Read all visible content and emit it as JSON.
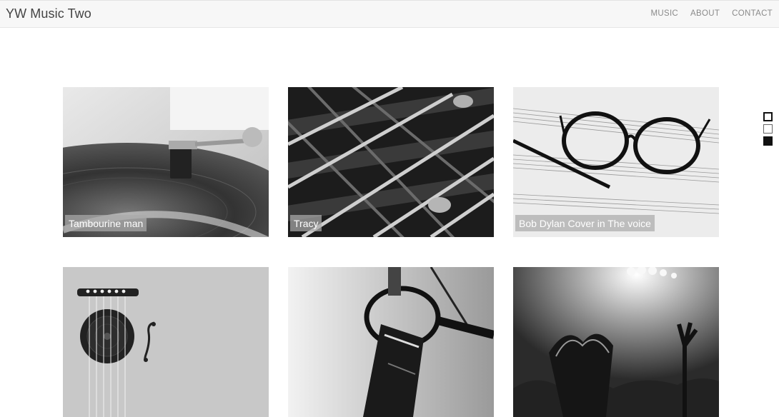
{
  "header": {
    "brand": "YW Music Two",
    "nav": [
      "MUSIC",
      "ABOUT",
      "CONTACT"
    ]
  },
  "gallery": {
    "cards": [
      {
        "caption": "Tambourine man",
        "image": "turntable-photo"
      },
      {
        "caption": "Tracy",
        "image": "guitar-strings-photo"
      },
      {
        "caption": "Bob Dylan Cover in The voice",
        "image": "glasses-on-sheet-music-photo"
      },
      {
        "caption": "",
        "image": "guitar-illustration"
      },
      {
        "caption": "",
        "image": "microphone-photo"
      },
      {
        "caption": "",
        "image": "concert-crowd-photo"
      }
    ]
  },
  "side_dots": {
    "count": 3,
    "active_index": 2
  },
  "colors": {
    "navbar_bg": "#f7f7f7",
    "caption_bg": "#aaaaaa",
    "page_bg": "#ffffff"
  }
}
